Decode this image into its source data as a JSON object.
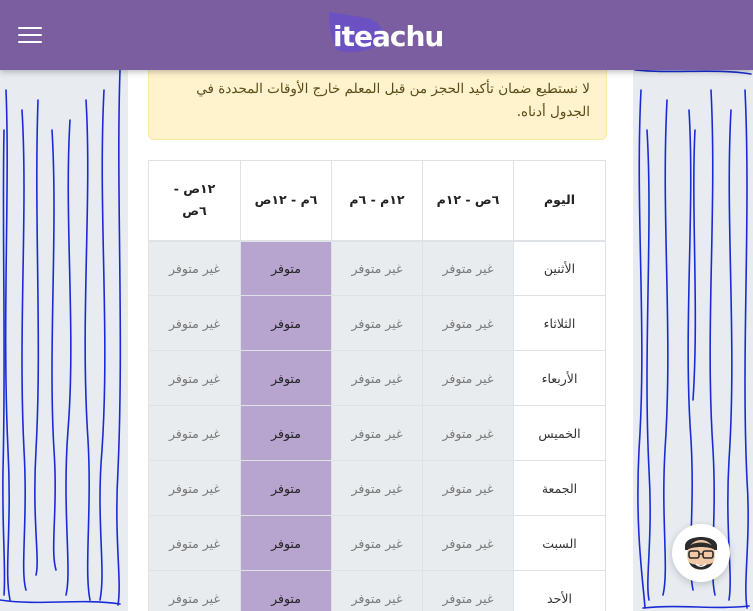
{
  "header": {
    "logo_text": "iteachu",
    "menu_icon": "hamburger-menu-icon"
  },
  "notice": {
    "line1": "لا نستطيع ضمان تأكيد الحجز من قبل المعلم خارج الأوقات المحددة في",
    "line2": "الجدول أدناه."
  },
  "schedule": {
    "headers": {
      "day": "اليوم",
      "slot1": "٦ص - ١٢م",
      "slot2": "١٢م - ٦م",
      "slot3": "٦م - ١٢ص",
      "slot4_line1": "١٢ص -",
      "slot4_line2": "٦ص"
    },
    "rows": [
      {
        "day": "الأثنين",
        "slot1": "غير متوفر",
        "slot2": "غير متوفر",
        "slot3": "متوفر",
        "slot4": "غير متوفر"
      },
      {
        "day": "الثلاثاء",
        "slot1": "غير متوفر",
        "slot2": "غير متوفر",
        "slot3": "متوفر",
        "slot4": "غير متوفر"
      },
      {
        "day": "الأربعاء",
        "slot1": "غير متوفر",
        "slot2": "غير متوفر",
        "slot3": "متوفر",
        "slot4": "غير متوفر"
      },
      {
        "day": "الخميس",
        "slot1": "غير متوفر",
        "slot2": "غير متوفر",
        "slot3": "متوفر",
        "slot4": "غير متوفر"
      },
      {
        "day": "الجمعة",
        "slot1": "غير متوفر",
        "slot2": "غير متوفر",
        "slot3": "متوفر",
        "slot4": "غير متوفر"
      },
      {
        "day": "السبت",
        "slot1": "غير متوفر",
        "slot2": "غير متوفر",
        "slot3": "متوفر",
        "slot4": "غير متوفر"
      },
      {
        "day": "الأحد",
        "slot1": "غير متوفر",
        "slot2": "غير متوفر",
        "slot3": "متوفر",
        "slot4": "غير متوفر"
      }
    ]
  },
  "colors": {
    "header_bg": "#7a5ea0",
    "available_bg": "#b7a4cf",
    "unavailable_bg": "#e9ecef",
    "notice_bg": "#fff3cd",
    "scribble": "#1a2bd6"
  },
  "chat": {
    "icon": "support-avatar-icon"
  }
}
